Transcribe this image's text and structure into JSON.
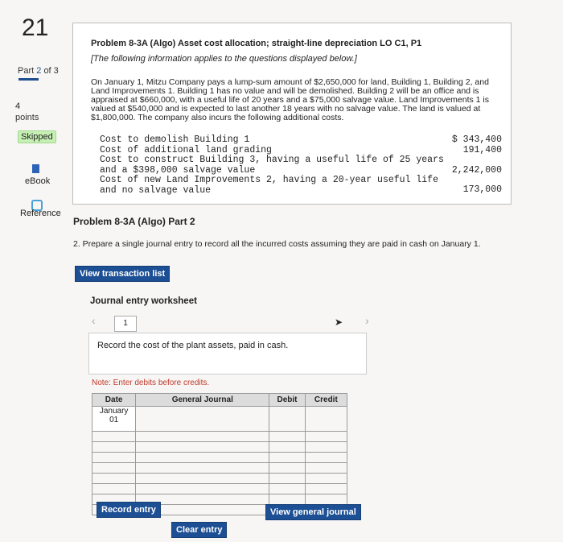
{
  "rail": {
    "question_number": "21",
    "part_label": "Part",
    "part_current": "2",
    "part_of": "of 3",
    "points_value": "4",
    "points_label": "points",
    "status_badge": "Skipped",
    "ebook_label": "eBook",
    "reference_label": "Reference"
  },
  "problem": {
    "title": "Problem 8-3A (Algo) Asset cost allocation; straight-line depreciation LO C1, P1",
    "note": "[The following information applies to the questions displayed below.]",
    "paragraph": "On January 1, Mitzu Company pays a lump-sum amount of $2,650,000 for land, Building 1, Building 2, and Land Improvements 1. Building 1 has no value and will be demolished. Building 2 will be an office and is appraised at $660,000, with a useful life of 20 years and a $75,000 salvage value. Land Improvements 1 is valued at $540,000 and is expected to last another 18 years with no salvage value. The land is valued at $1,800,000. The company also incurs the following additional costs.",
    "costs": [
      {
        "label": "Cost to demolish Building 1",
        "value": "$ 343,400"
      },
      {
        "label": "Cost of additional land grading",
        "value": "191,400"
      },
      {
        "label": "Cost to construct Building 3, having a useful life of 25 years and a $398,000 salvage value",
        "value": "2,242,000"
      },
      {
        "label": "Cost of new Land Improvements 2, having a 20-year useful life and no salvage value",
        "value": "173,000"
      }
    ]
  },
  "part2": {
    "heading": "Problem 8-3A (Algo) Part 2",
    "instruction": "2. Prepare a single journal entry to record all the incurred costs assuming they are paid in cash on January 1.",
    "view_transactions_label": "View transaction list"
  },
  "worksheet": {
    "title": "Journal entry worksheet",
    "page": "1",
    "description": "Record the cost of the plant assets, paid in cash.",
    "note_prefix": "Note: Enter debits before credits.",
    "headers": {
      "date": "Date",
      "general_journal": "General Journal",
      "debit": "Debit",
      "credit": "Credit"
    },
    "date_month": "January",
    "date_day": "01",
    "record_label": "Record entry",
    "clear_label": "Clear entry",
    "view_general_label": "View general journal"
  }
}
